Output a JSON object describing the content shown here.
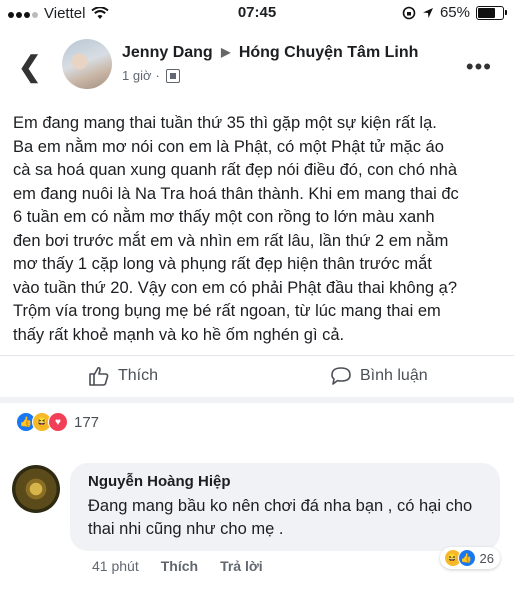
{
  "status_bar": {
    "carrier": "Viettel",
    "time": "07:45",
    "battery": "65%",
    "battery_level": 0.65
  },
  "post": {
    "author": "Jenny Dang",
    "group": "Hóng Chuyện Tâm Linh",
    "time_ago": "1 giờ",
    "text": "Em đang mang thai tuần thứ 35 thì gặp một sự kiện rất lạ.\nBa em nằm mơ nói con em là Phật, có một Phật tử mặc áo\ncà sa hoá quan xung quanh rất đẹp nói điều đó, con chó nhà\nem đang nuôi là Na Tra hoá thân thành. Khi em mang thai đc\n6 tuần em có nằm mơ thấy một con rồng to lớn màu xanh\nđen bơi trước mắt em và nhìn em rất lâu, lần thứ 2 em nằm\nmơ thấy 1 cặp long và phụng rất đẹp hiện thân trước mắt\nvào tuần thứ 20. Vậy con em có phải Phật đầu thai không ạ?\nTrộm vía trong bụng mẹ bé rất ngoan, từ lúc mang thai em\nthấy rất khoẻ mạnh và ko hề ốm nghén gì cả.",
    "like_label": "Thích",
    "comment_label": "Bình luận",
    "reaction_count": "177"
  },
  "comment": {
    "author": "Nguyễn Hoàng Hiệp",
    "text": "Đang mang bầu ko nên chơi đá nha bạn , có hại cho thai nhi cũng như cho mẹ .",
    "time_ago": "41 phút",
    "like_label": "Thích",
    "reply_label": "Trả lời",
    "reaction_count": "26"
  },
  "icons": [
    "back-chevron-icon",
    "more-icon",
    "globe-icon",
    "like-icon",
    "comment-icon",
    "like-reaction-icon",
    "haha-reaction-icon",
    "love-reaction-icon",
    "wifi-icon",
    "location-icon",
    "lock-rotation-icon",
    "battery-icon"
  ],
  "colors": {
    "link_blue": "#1877f2",
    "text": "#1c1e21",
    "muted": "#606770",
    "bubble_bg": "#f0f2f5"
  }
}
